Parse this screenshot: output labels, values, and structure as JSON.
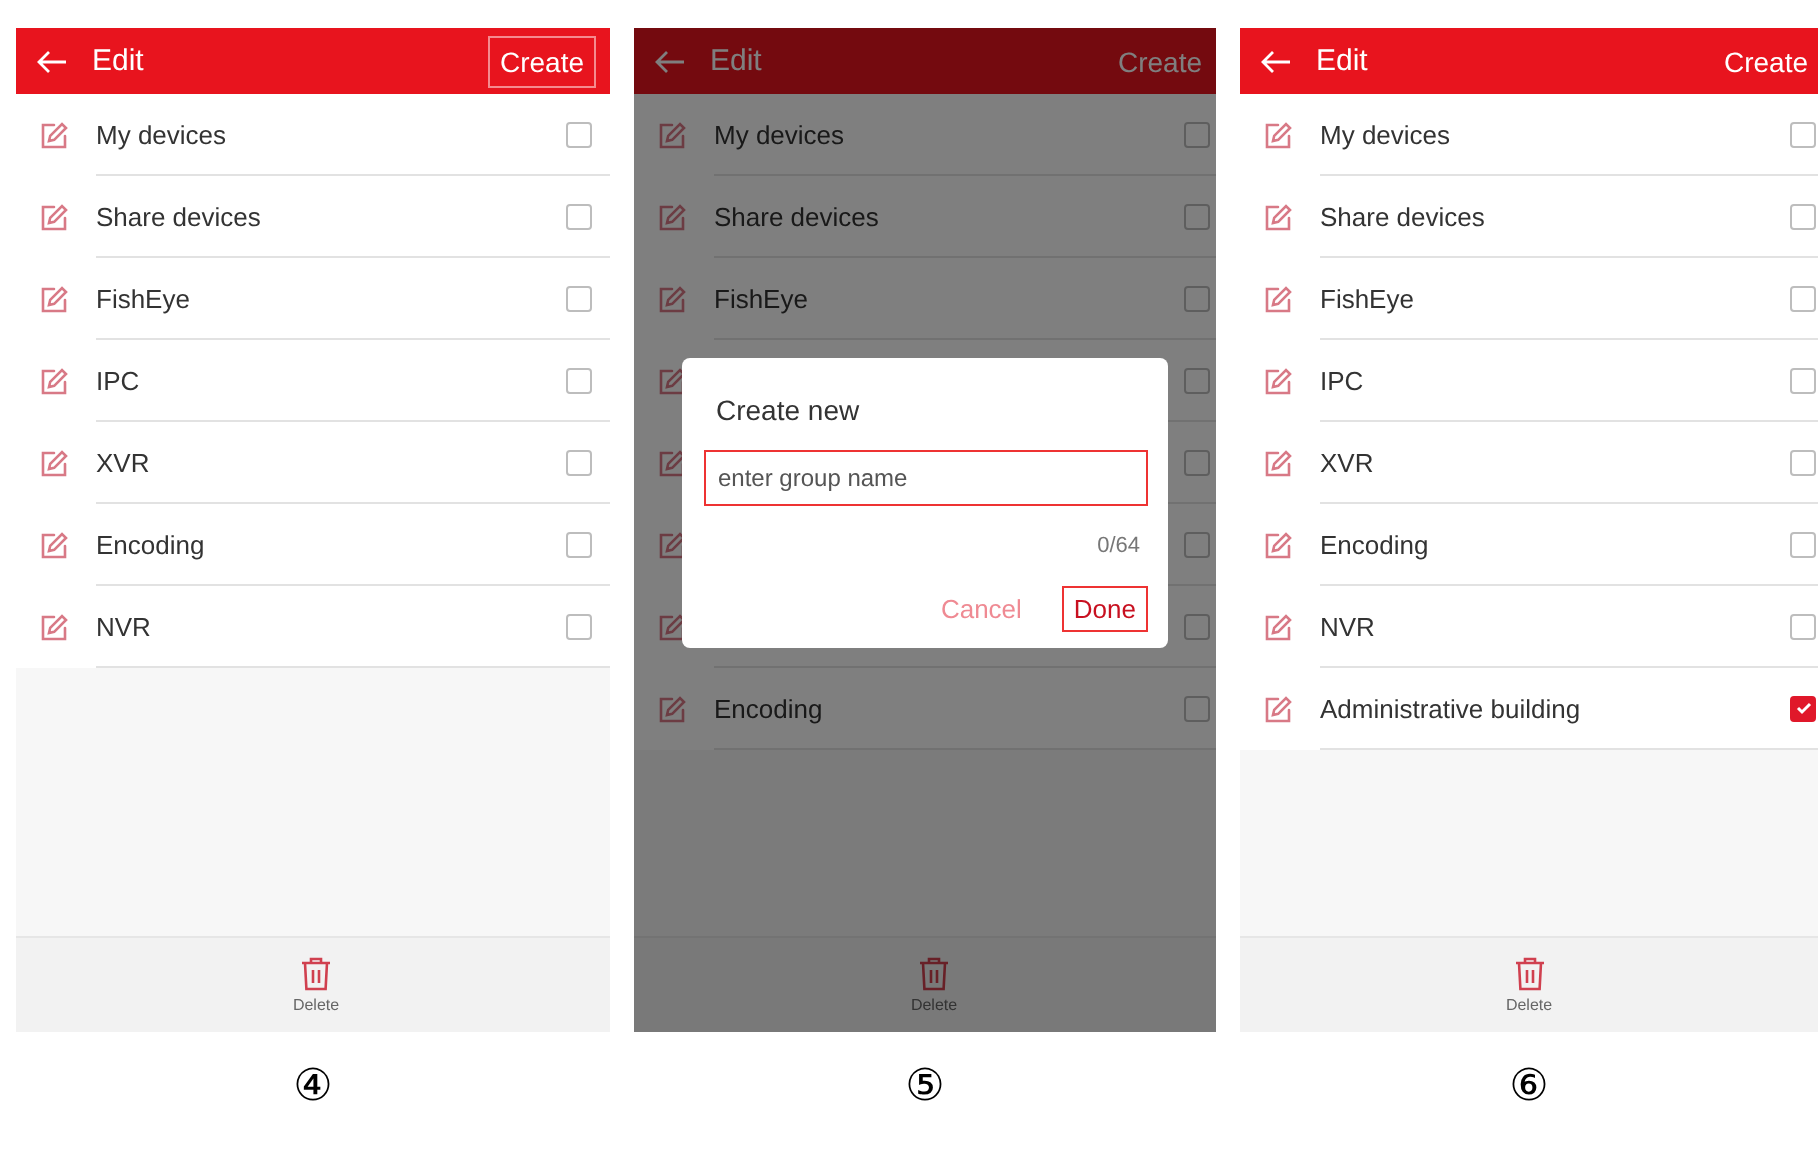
{
  "panels": [
    {
      "caption": "④",
      "title": "Edit",
      "action": {
        "label": "Create",
        "highlighted": true
      },
      "dimmed": false,
      "delete_label": "Delete",
      "rows": [
        {
          "label": "My devices",
          "checked": false
        },
        {
          "label": "Share devices",
          "checked": false
        },
        {
          "label": "FishEye",
          "checked": false
        },
        {
          "label": "IPC",
          "checked": false
        },
        {
          "label": "XVR",
          "checked": false
        },
        {
          "label": "Encoding",
          "checked": false
        },
        {
          "label": "NVR",
          "checked": false
        }
      ]
    },
    {
      "caption": "⑤",
      "title": "Edit",
      "action": {
        "label": "Create",
        "highlighted": false
      },
      "dimmed": true,
      "delete_label": "Delete",
      "rows": [
        {
          "label": "My devices",
          "checked": false
        },
        {
          "label": "Share devices",
          "checked": false
        },
        {
          "label": "FishEye",
          "checked": false
        },
        {
          "checked": false
        },
        {
          "checked": false
        },
        {
          "checked": false
        },
        {
          "checked": false
        },
        {
          "label": "Encoding",
          "checked": false
        }
      ],
      "dialog": {
        "title": "Create new",
        "placeholder": "enter group name",
        "counter": "0/64",
        "buttons": [
          {
            "label": "Cancel",
            "highlighted": false
          },
          {
            "label": "Done",
            "highlighted": true
          }
        ]
      }
    },
    {
      "caption": "⑥",
      "title": "Edit",
      "action": {
        "label": "Create",
        "highlighted": false
      },
      "dimmed": false,
      "delete_label": "Delete",
      "rows": [
        {
          "label": "My devices",
          "checked": false
        },
        {
          "label": "Share devices",
          "checked": false
        },
        {
          "label": "FishEye",
          "checked": false
        },
        {
          "label": "IPC",
          "checked": false
        },
        {
          "label": "XVR",
          "checked": false
        },
        {
          "label": "Encoding",
          "checked": false
        },
        {
          "label": "NVR",
          "checked": false
        },
        {
          "label": "Administrative building",
          "checked": true
        }
      ]
    }
  ]
}
